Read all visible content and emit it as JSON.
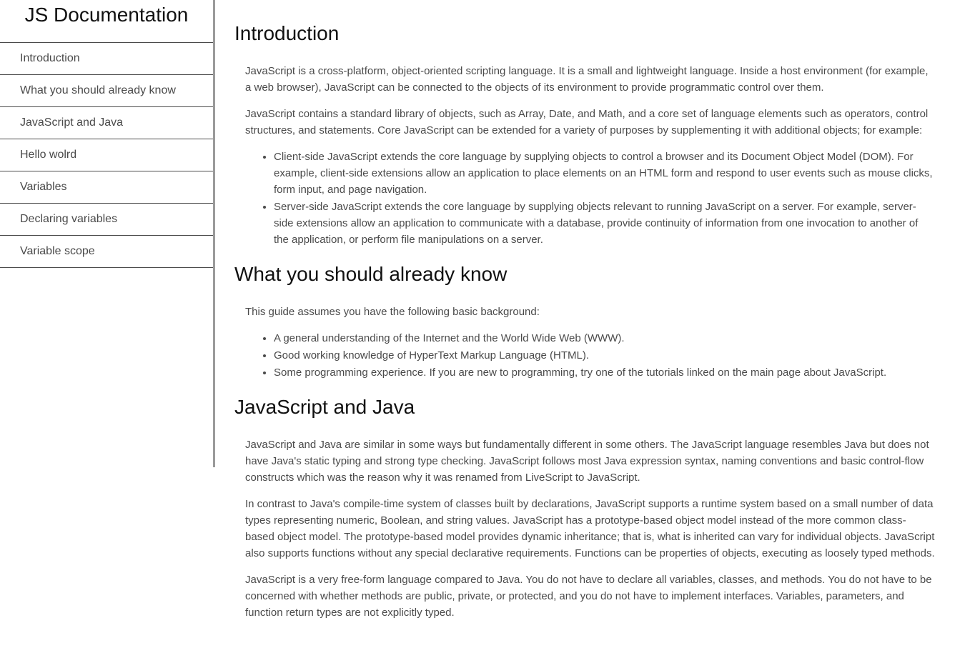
{
  "nav": {
    "title": "JS Documentation",
    "items": [
      "Introduction",
      "What you should already know",
      "JavaScript and Java",
      "Hello wolrd",
      "Variables",
      "Declaring variables",
      "Variable scope"
    ]
  },
  "sections": {
    "introduction": {
      "title": "Introduction",
      "p1": "JavaScript is a cross-platform, object-oriented scripting language. It is a small and lightweight language. Inside a host environment (for example, a web browser), JavaScript can be connected to the objects of its environment to provide programmatic control over them.",
      "p2": "JavaScript contains a standard library of objects, such as Array, Date, and Math, and a core set of language elements such as operators, control structures, and statements. Core JavaScript can be extended for a variety of purposes by supplementing it with additional objects; for example:",
      "bullets": [
        "Client-side JavaScript extends the core language by supplying objects to control a browser and its Document Object Model (DOM). For example, client-side extensions allow an application to place elements on an HTML form and respond to user events such as mouse clicks, form input, and page navigation.",
        "Server-side JavaScript extends the core language by supplying objects relevant to running JavaScript on a server. For example, server-side extensions allow an application to communicate with a database, provide continuity of information from one invocation to another of the application, or perform file manipulations on a server."
      ]
    },
    "know": {
      "title": "What you should already know",
      "p1": "This guide assumes you have the following basic background:",
      "bullets": [
        "A general understanding of the Internet and the World Wide Web (WWW).",
        "Good working knowledge of HyperText Markup Language (HTML).",
        "Some programming experience. If you are new to programming, try one of the tutorials linked on the main page about JavaScript."
      ]
    },
    "java": {
      "title": "JavaScript and Java",
      "p1": "JavaScript and Java are similar in some ways but fundamentally different in some others. The JavaScript language resembles Java but does not have Java's static typing and strong type checking. JavaScript follows most Java expression syntax, naming conventions and basic control-flow constructs which was the reason why it was renamed from LiveScript to JavaScript.",
      "p2": "In contrast to Java's compile-time system of classes built by declarations, JavaScript supports a runtime system based on a small number of data types representing numeric, Boolean, and string values. JavaScript has a prototype-based object model instead of the more common class-based object model. The prototype-based model provides dynamic inheritance; that is, what is inherited can vary for individual objects. JavaScript also supports functions without any special declarative requirements. Functions can be properties of objects, executing as loosely typed methods.",
      "p3": "JavaScript is a very free-form language compared to Java. You do not have to declare all variables, classes, and methods. You do not have to be concerned with whether methods are public, private, or protected, and you do not have to implement interfaces. Variables, parameters, and function return types are not explicitly typed."
    }
  }
}
